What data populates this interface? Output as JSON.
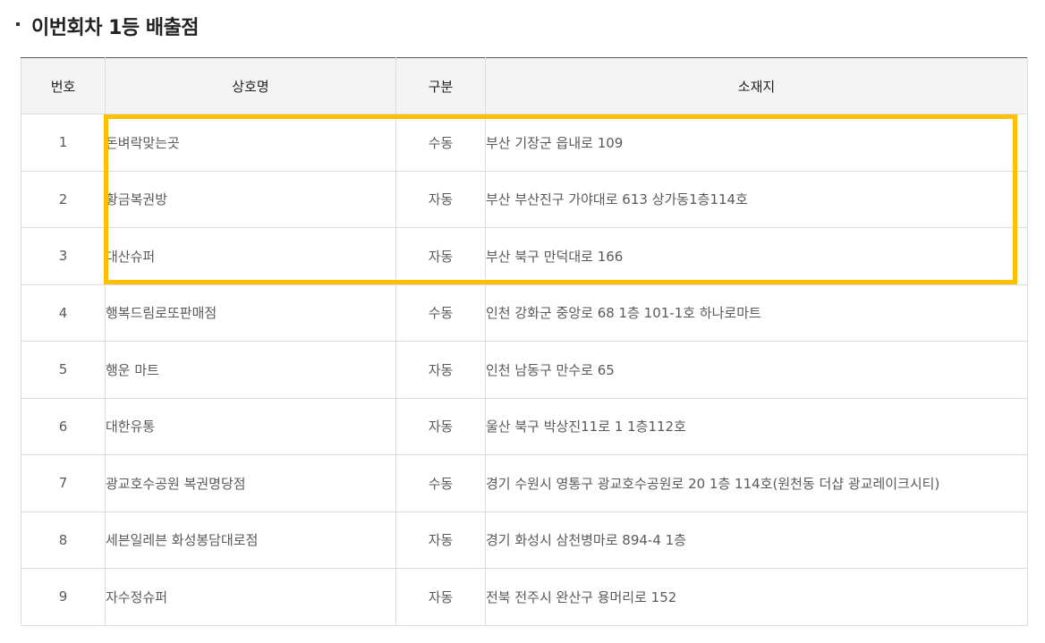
{
  "section": {
    "title": "이번회차 1등 배출점"
  },
  "table": {
    "headers": {
      "no": "번호",
      "name": "상호명",
      "kind": "구분",
      "address": "소재지"
    },
    "rows": [
      {
        "no": "1",
        "name": "돈벼락맞는곳",
        "kind": "수동",
        "address": "부산 기장군 읍내로 109"
      },
      {
        "no": "2",
        "name": "황금복권방",
        "kind": "자동",
        "address": "부산 부산진구 가야대로 613 상가동1층114호"
      },
      {
        "no": "3",
        "name": "대산슈퍼",
        "kind": "자동",
        "address": "부산 북구 만덕대로 166"
      },
      {
        "no": "4",
        "name": "행복드림로또판매점",
        "kind": "수동",
        "address": "인천 강화군 중앙로 68 1층 101-1호 하나로마트"
      },
      {
        "no": "5",
        "name": "행운 마트",
        "kind": "자동",
        "address": "인천 남동구 만수로 65"
      },
      {
        "no": "6",
        "name": "대한유통",
        "kind": "자동",
        "address": "울산 북구 박상진11로 1 1층112호"
      },
      {
        "no": "7",
        "name": "광교호수공원 복권명당점",
        "kind": "수동",
        "address": "경기 수원시 영통구 광교호수공원로 20 1층 114호(원천동 더샵 광교레이크시티)"
      },
      {
        "no": "8",
        "name": "세븐일레븐 화성봉담대로점",
        "kind": "자동",
        "address": "경기 화성시 삼천병마로 894-4 1층"
      },
      {
        "no": "9",
        "name": "자수정슈퍼",
        "kind": "자동",
        "address": "전북 전주시 완산구 용머리로 152"
      }
    ]
  },
  "highlight": {
    "color": "#ffc000",
    "rows_covered": [
      "1",
      "2",
      "3"
    ]
  }
}
